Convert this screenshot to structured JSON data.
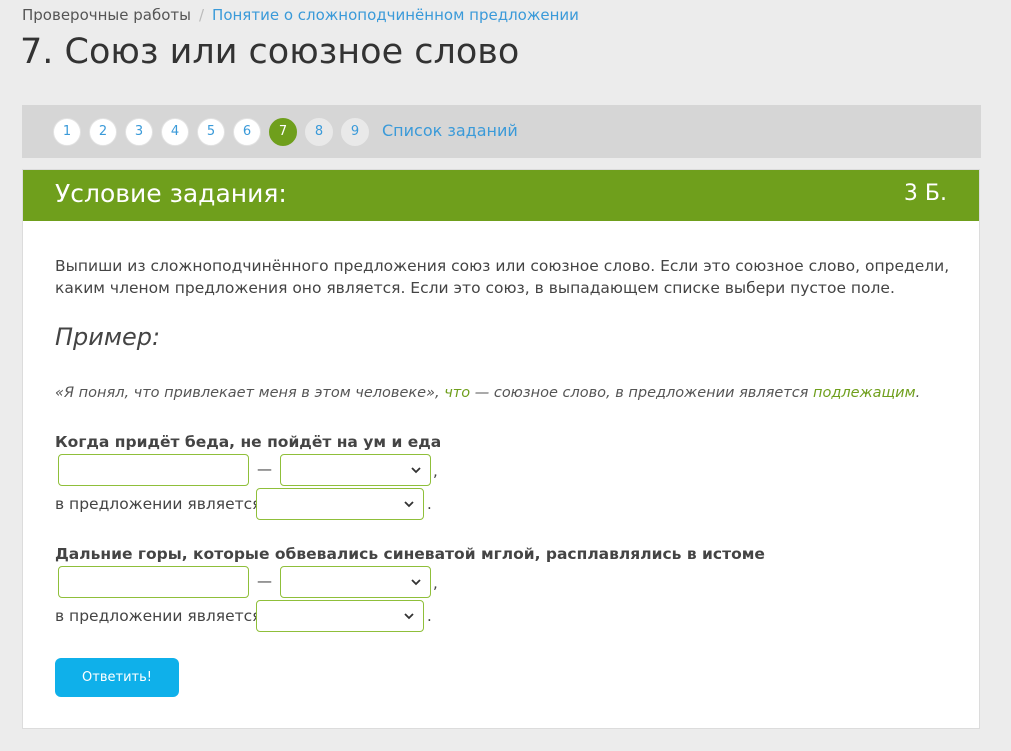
{
  "breadcrumb": {
    "root": "Проверочные работы",
    "separator": "/",
    "current": "Понятие о сложноподчинённом предложении"
  },
  "page_title": "7. Союз или союзное слово",
  "task_nav": {
    "items": [
      "1",
      "2",
      "3",
      "4",
      "5",
      "6",
      "7",
      "8",
      "9"
    ],
    "active": "7",
    "list_label": "Список заданий"
  },
  "task": {
    "header_title": "Условие задания:",
    "points": "3 Б.",
    "instruction": "Выпиши из сложноподчинённого предложения союз или союзное слово. Если это союзное слово, определи, каким членом предложения оно является. Если это союз, в выпадающем списке выбери пустое поле.",
    "example_heading": "Пример:",
    "example": {
      "quote": "«Я понял, что привлекает меня в этом человеке»,",
      "word": "что",
      "middle": "— союзное слово, в предложении является",
      "role": "подлежащим",
      "end": "."
    },
    "questions": [
      {
        "sentence": "Когда придёт беда, не пойдёт на ум и еда",
        "answer_value": "",
        "dash": "—",
        "comma": ",",
        "role_label": "в предложении является",
        "period": "."
      },
      {
        "sentence": "Дальние горы, которые обвевались синеватой мглой, расплавлялись в истоме",
        "answer_value": "",
        "dash": "—",
        "comma": ",",
        "role_label": "в предложении является",
        "period": "."
      }
    ],
    "submit_label": "Ответить!"
  },
  "colors": {
    "accent_green": "#6f9f1c",
    "link_blue": "#3a9ad9",
    "button_blue": "#0fb0ea",
    "input_border": "#8fbf3a"
  },
  "icons": {
    "select_arrow": "chevron-down-icon"
  }
}
